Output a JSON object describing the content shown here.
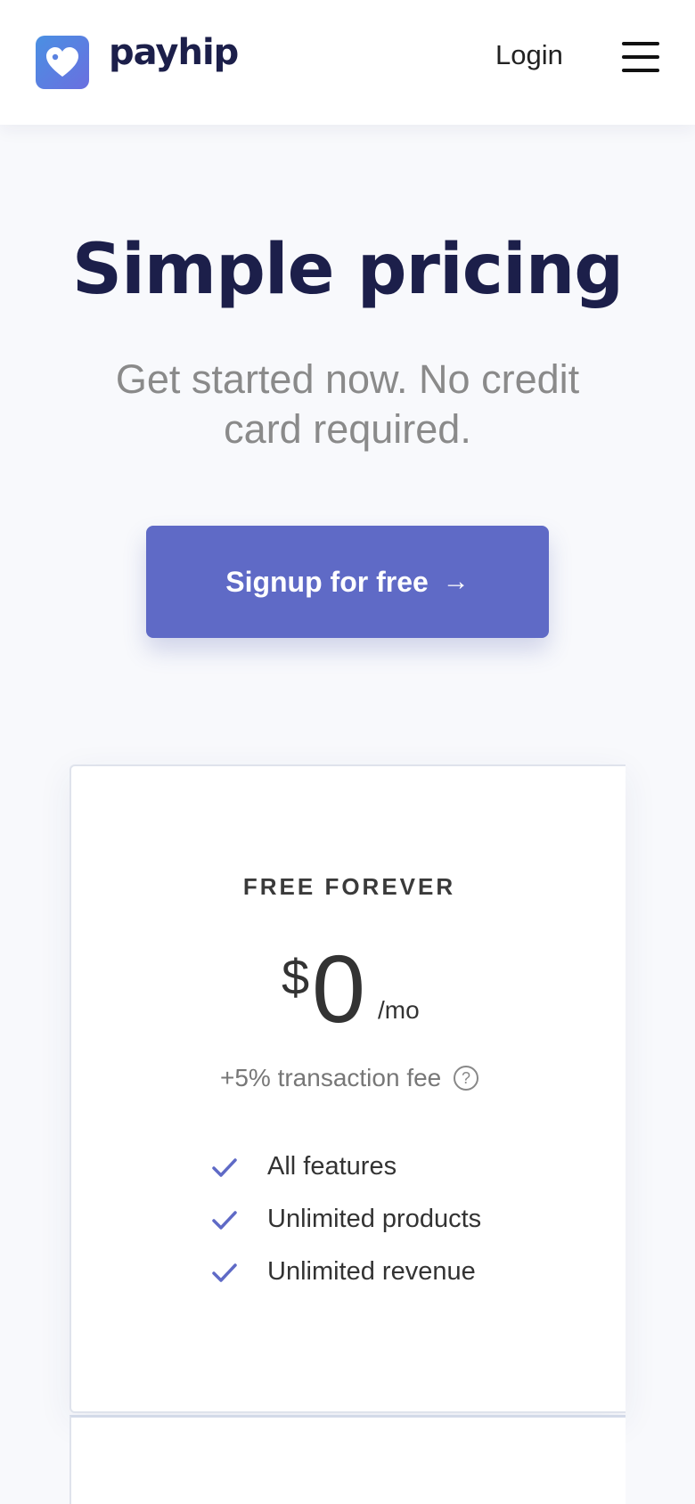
{
  "header": {
    "logo_text": "payhip",
    "login_label": "Login",
    "icons": {
      "logo": "payhip-heart-tag-icon",
      "menu": "hamburger-menu-icon"
    }
  },
  "hero": {
    "title": "Simple pricing",
    "subtitle": "Get started now. No credit card required.",
    "cta_label": "Signup for free",
    "cta_arrow": "→"
  },
  "plan": {
    "name": "FREE FOREVER",
    "currency": "$",
    "amount": "0",
    "period": "/mo",
    "fee": "+5% transaction fee",
    "fee_help": "?",
    "features": [
      "All features",
      "Unlimited products",
      "Unlimited revenue"
    ]
  },
  "colors": {
    "brand_navy": "#1c1f4a",
    "accent_purple": "#5f6ac6",
    "logo_gradient_start": "#4a90e2",
    "logo_gradient_end": "#6a6fe0",
    "check": "#5f6ac6"
  }
}
